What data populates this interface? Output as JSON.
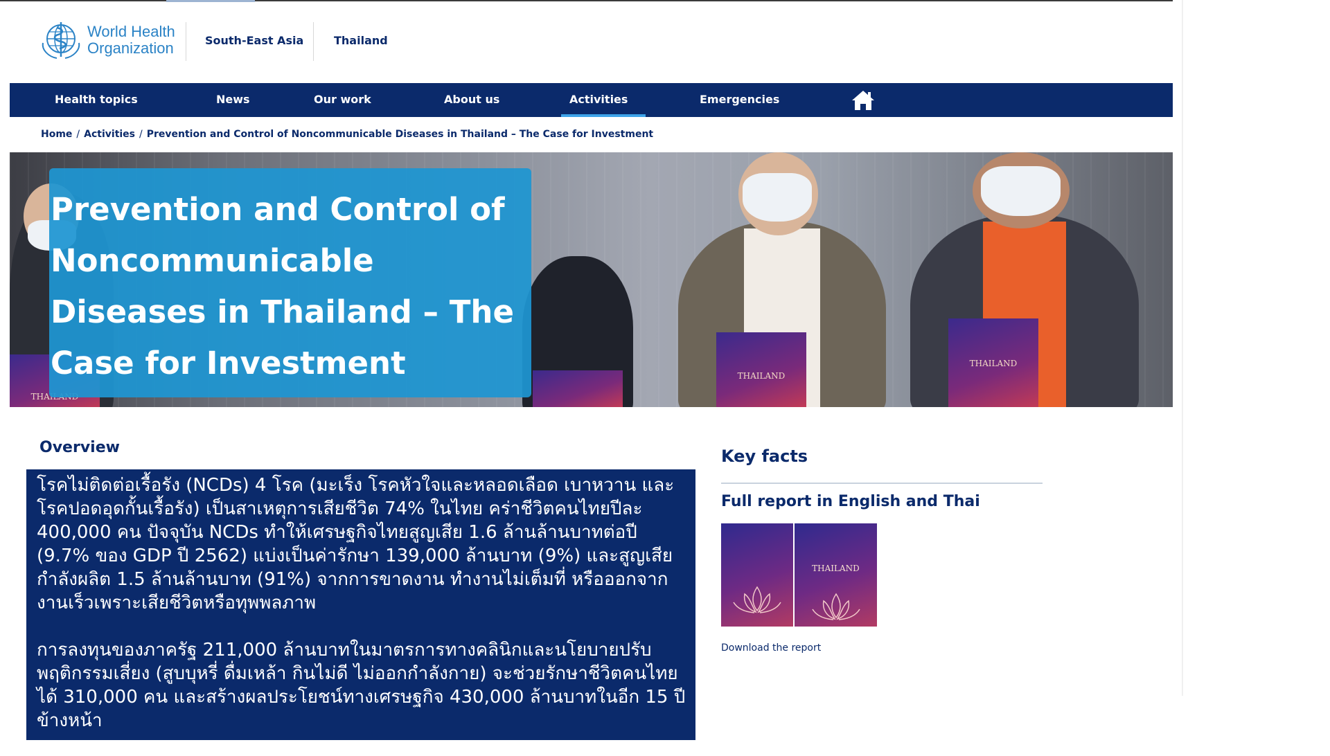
{
  "header": {
    "logo_text_line1": "World Health",
    "logo_text_line2": "Organization",
    "region_link": "South-East Asia",
    "country_link": "Thailand"
  },
  "nav": {
    "items": [
      {
        "label": "Health topics"
      },
      {
        "label": "News"
      },
      {
        "label": "Our work"
      },
      {
        "label": "About us"
      },
      {
        "label": "Activities",
        "active": true
      },
      {
        "label": "Emergencies"
      }
    ],
    "home_icon": "home-icon"
  },
  "breadcrumb": {
    "home": "Home",
    "activities": "Activities",
    "current": "Prevention and Control of Noncommunicable Diseases in Thailand – The Case for Investment"
  },
  "hero": {
    "title": "Prevention and Control of Noncommunicable Diseases in Thailand – The Case for Investment",
    "book_label": "THAILAND"
  },
  "overview": {
    "heading": "Overview",
    "paragraph1": "โรคไม่ติดต่อเรื้อรัง (NCDs) 4 โรค (มะเร็ง โรคหัวใจและหลอดเลือด เบาหวาน และโรคปอดอุดกั้นเรื้อรัง) เป็นสาเหตุการเสียชีวิต 74% ในไทย คร่าชีวิตคนไทยปีละ 400,000 คน  ปัจจุบัน NCDs ทำให้เศรษฐกิจไทยสูญเสีย 1.6 ล้านล้านบาทต่อปี (9.7% ของ GDP ปี 2562) แบ่งเป็นค่ารักษา 139,000 ล้านบาท (9%) และสูญเสียกำลังผลิต 1.5 ล้านล้านบาท (91%) จากการขาดงาน ทำงานไม่เต็มที่ หรือออกจากงานเร็วเพราะเสียชีวิตหรือทุพพลภาพ",
    "paragraph2": "การลงทุนของภาครัฐ 211,000 ล้านบาทในมาตรการทางคลินิกและนโยบายปรับพฤติกรรมเสี่ยง (สูบบุหรี่ ดื่มเหล้า กินไม่ดี ไม่ออกกำลังกาย) จะช่วยรักษาชีวิตคนไทยได้ 310,000 คน และสร้างผลประโยชน์ทางเศรษฐกิจ 430,000 ล้านบาทในอีก 15 ปีข้างหน้า"
  },
  "sidebar": {
    "key_facts_heading": "Key facts",
    "report_heading": "Full report in English and Thai",
    "cover_right_title": "THAILAND",
    "download_link": "Download the report"
  },
  "colors": {
    "navy": "#0b2a6b",
    "accent_blue": "#1e96d2",
    "underline_blue": "#3ea3e8"
  }
}
